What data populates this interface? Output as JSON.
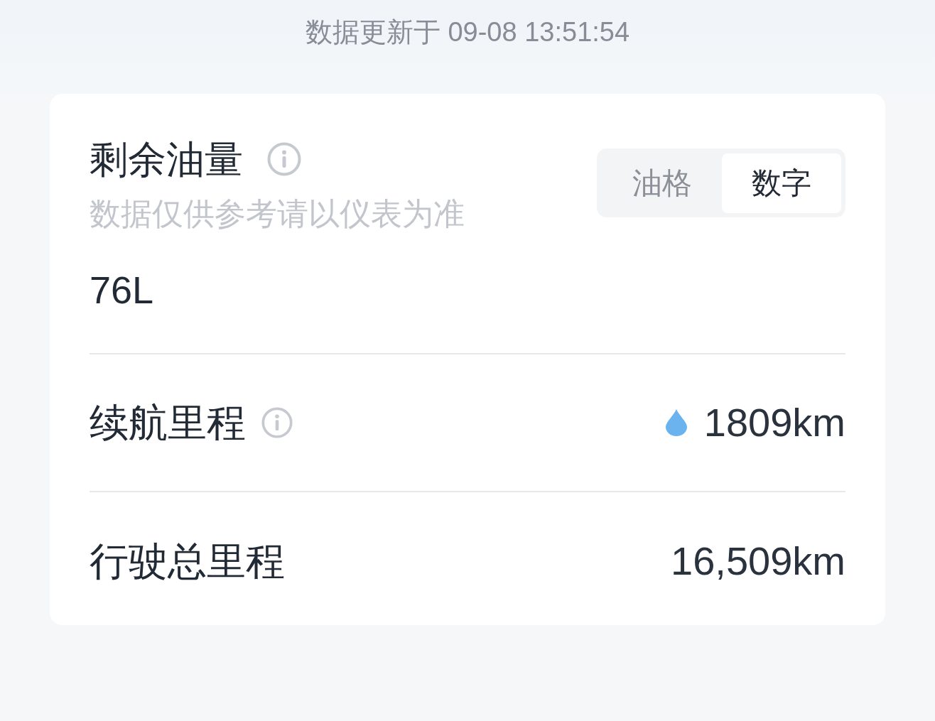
{
  "header": {
    "updated_text": "数据更新于 09-08 13:51:54"
  },
  "fuel": {
    "title": "剩余油量",
    "subtitle": "数据仅供参考请以仪表为准",
    "display_modes": [
      {
        "label": "油格",
        "selected": false
      },
      {
        "label": "数字",
        "selected": true
      }
    ],
    "value": "76L"
  },
  "rows": [
    {
      "kind": "range",
      "label": "续航里程",
      "value": "1809km"
    },
    {
      "kind": "total",
      "label": "行驶总里程",
      "value": "16,509km"
    }
  ]
}
